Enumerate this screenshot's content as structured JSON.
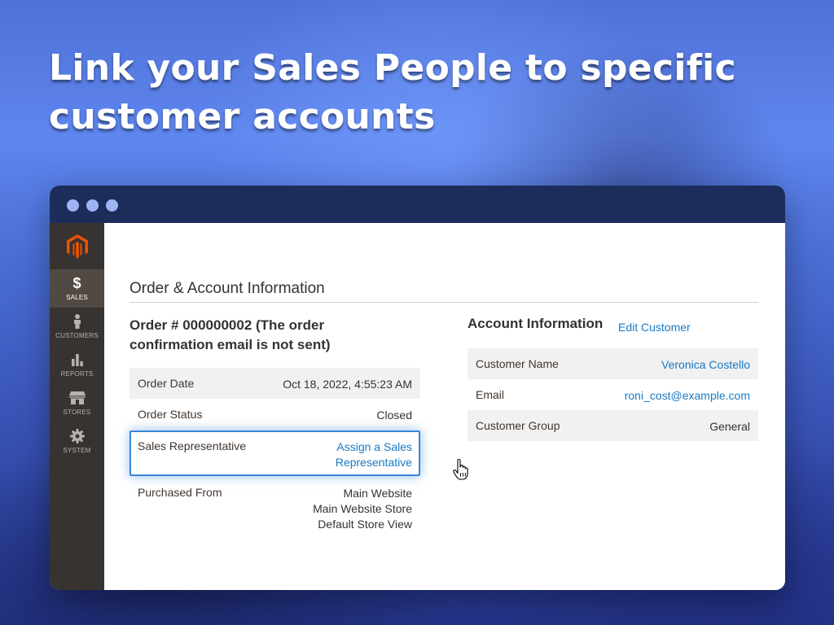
{
  "headline": "Link your Sales People to specific customer accounts",
  "sidebar": {
    "items": [
      {
        "label": "SALES",
        "icon": "dollar-icon",
        "active": true
      },
      {
        "label": "CUSTOMERS",
        "icon": "person-icon",
        "active": false
      },
      {
        "label": "REPORTS",
        "icon": "bar-chart-icon",
        "active": false
      },
      {
        "label": "STORES",
        "icon": "storefront-icon",
        "active": false
      },
      {
        "label": "SYSTEM",
        "icon": "gear-icon",
        "active": false
      }
    ]
  },
  "section_title": "Order & Account Information",
  "order": {
    "heading": "Order # 000000002 (The order confirmation email is not sent)",
    "date_label": "Order Date",
    "date_value": "Oct 18, 2022, 4:55:23 AM",
    "status_label": "Order Status",
    "status_value": "Closed",
    "salesrep_label": "Sales Representative",
    "salesrep_link": "Assign a Sales Representative",
    "purchased_label": "Purchased From",
    "purchased_line1": "Main Website",
    "purchased_line2": "Main Website Store",
    "purchased_line3": "Default Store View"
  },
  "account": {
    "heading": "Account Information",
    "edit_link": "Edit Customer",
    "name_label": "Customer Name",
    "name_value": "Veronica Costello",
    "email_label": "Email",
    "email_value": "roni_cost@example.com",
    "group_label": "Customer Group",
    "group_value": "General"
  },
  "colors": {
    "titlebar": "#1d2d5b",
    "sidebar": "#373330",
    "sidebar_active": "#514943",
    "logo": "#eb5202",
    "link": "#1979c3",
    "highlight_border": "#3a86d8"
  }
}
